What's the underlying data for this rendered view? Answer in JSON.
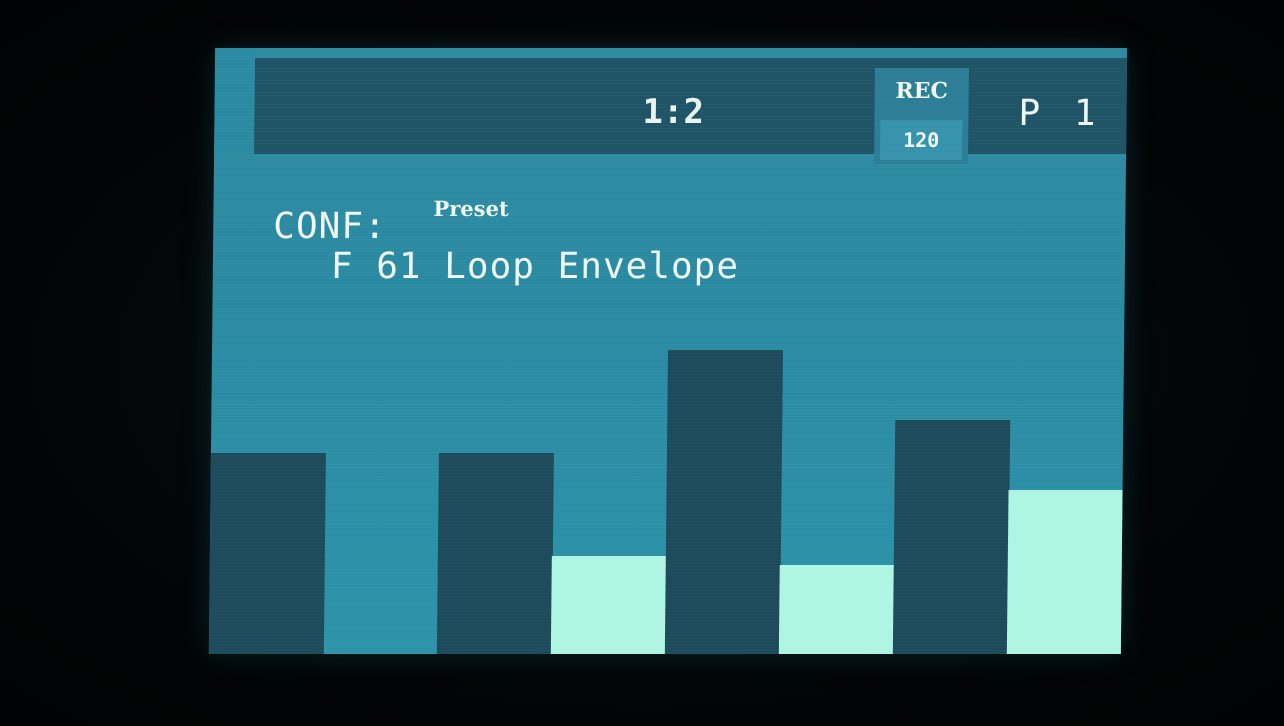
{
  "header": {
    "position": "1:2",
    "rec_label": "REC",
    "tempo": "120",
    "pattern": "P 1"
  },
  "config": {
    "label": "CONF:",
    "sub_label": "Preset",
    "preset_name": "F 61 Loop Envelope"
  },
  "steps": [
    {
      "level": 0.43,
      "style": "dark"
    },
    {
      "level": 0.0,
      "style": "dark"
    },
    {
      "level": 0.43,
      "style": "dark"
    },
    {
      "level": 0.21,
      "style": "light"
    },
    {
      "level": 0.65,
      "style": "dark"
    },
    {
      "level": 0.19,
      "style": "light"
    },
    {
      "level": 0.5,
      "style": "dark"
    },
    {
      "level": 0.35,
      "style": "light"
    }
  ],
  "colors": {
    "background": "#2a8aa2",
    "bar_dark": "#1d4b5c",
    "bar_light": "#aef5e2",
    "text": "#eef8f4"
  }
}
